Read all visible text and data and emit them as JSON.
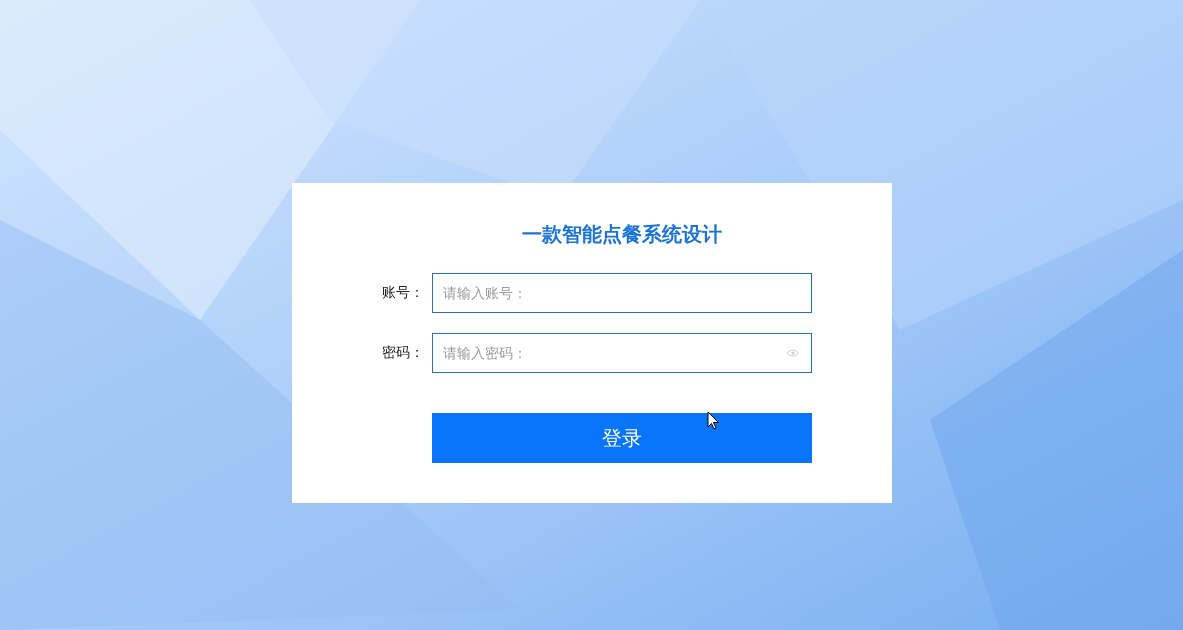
{
  "login_card": {
    "title": "一款智能点餐系统设计",
    "fields": [
      {
        "label": "账号：",
        "placeholder": "请输入账号：",
        "kind": "text"
      },
      {
        "label": "密码：",
        "placeholder": "请输入密码：",
        "kind": "password"
      }
    ],
    "submit_button": "登录"
  }
}
